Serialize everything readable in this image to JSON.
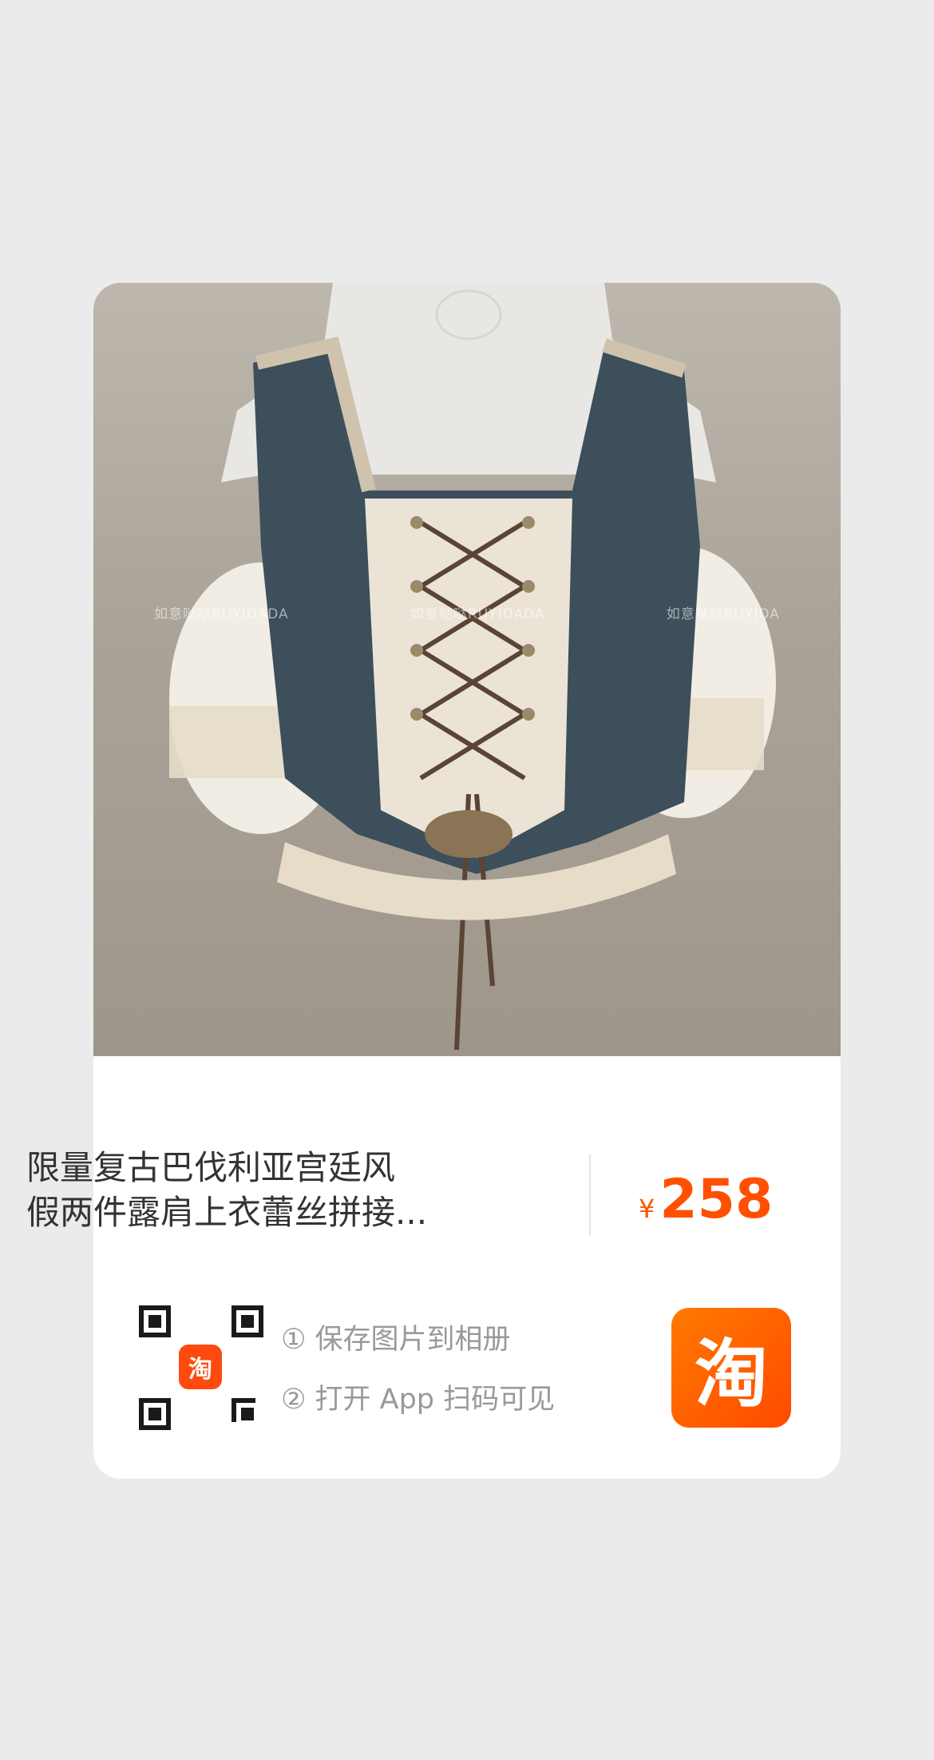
{
  "product": {
    "title_line1": "限量复古巴伐利亚宫廷风",
    "title_line2": "假两件露肩上衣蕾丝拼接...",
    "currency_symbol": "¥",
    "price": "258",
    "watermarks": [
      "如意哒哒RUYIDADA",
      "如意哒哒RUYIDADA",
      "如意哒哒RUYIDA"
    ]
  },
  "share": {
    "qr_badge_glyph": "淘",
    "step1": "① 保存图片到相册",
    "step2": "② 打开 App 扫码可见"
  },
  "app": {
    "icon_glyph": "淘"
  },
  "colors": {
    "accent": "#ff5000",
    "background": "#ebebeb",
    "card": "#ffffff"
  }
}
